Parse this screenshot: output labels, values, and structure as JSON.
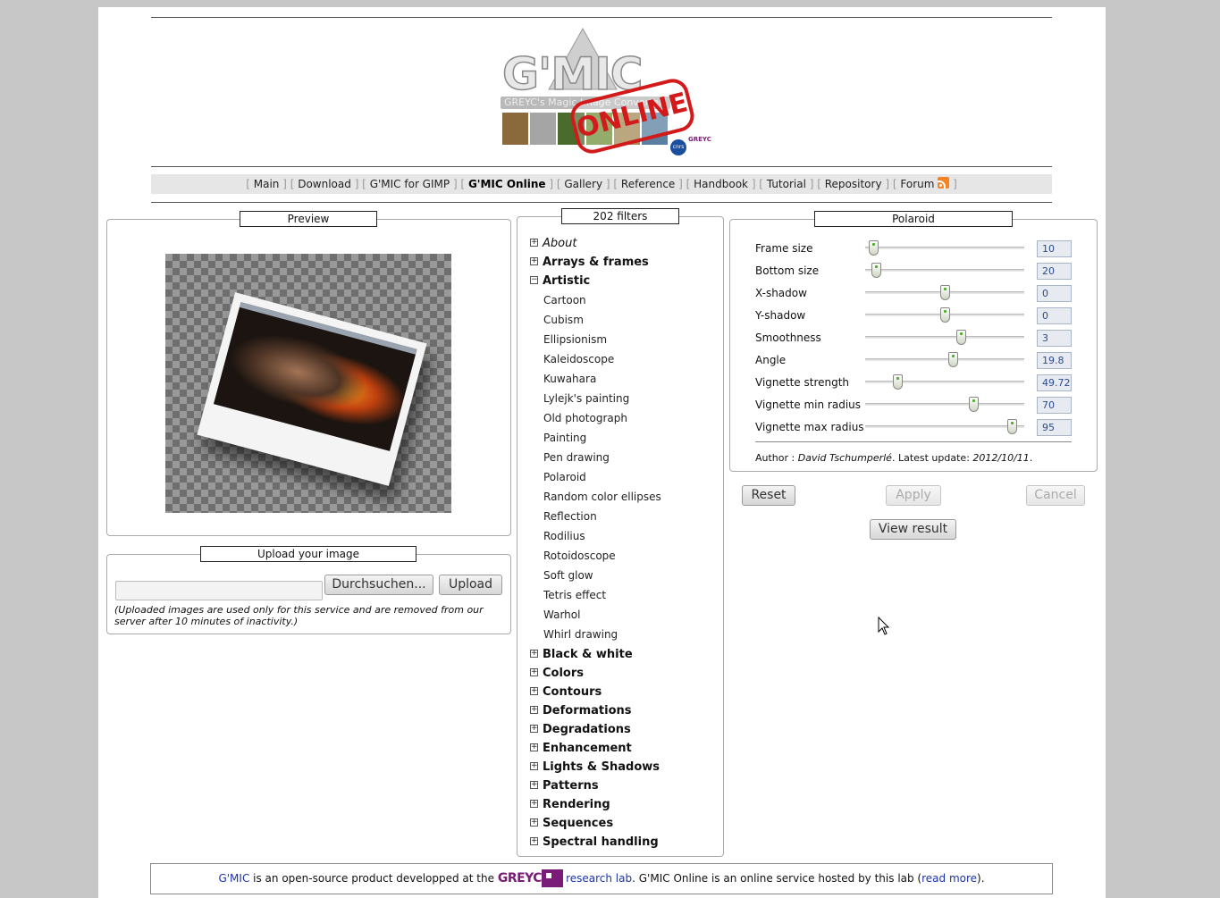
{
  "nav": {
    "items": [
      "Main",
      "Download",
      "G'MIC for GIMP",
      "G'MIC Online",
      "Gallery",
      "Reference",
      "Handbook",
      "Tutorial",
      "Repository",
      "Forum"
    ],
    "active": "G'MIC Online"
  },
  "logo": {
    "title": "G'MIC",
    "subtitle": "GREYC's Magic Image Converter",
    "stamp": "ONLINE",
    "greyc": "GREYC",
    "cnrs": "cnrs"
  },
  "preview": {
    "legend": "Preview"
  },
  "upload": {
    "legend": "Upload your image",
    "browse_label": "Durchsuchen...",
    "upload_label": "Upload",
    "note": "(Uploaded images are used only for this service and are removed from our server after 10 minutes of inactivity.)"
  },
  "filters": {
    "legend": "202 filters",
    "about": "About",
    "categories_before": [
      "Arrays & frames"
    ],
    "open_category": "Artistic",
    "artistic_items": [
      "Cartoon",
      "Cubism",
      "Ellipsionism",
      "Kaleidoscope",
      "Kuwahara",
      "Lylejk's painting",
      "Old photograph",
      "Painting",
      "Pen drawing",
      "Polaroid",
      "Random color ellipses",
      "Reflection",
      "Rodilius",
      "Rotoidoscope",
      "Soft glow",
      "Tetris effect",
      "Warhol",
      "Whirl drawing"
    ],
    "categories_after": [
      "Black & white",
      "Colors",
      "Contours",
      "Deformations",
      "Degradations",
      "Enhancement",
      "Lights & Shadows",
      "Patterns",
      "Rendering",
      "Sequences",
      "Spectral handling"
    ]
  },
  "params": {
    "legend": "Polaroid",
    "items": [
      {
        "label": "Frame size",
        "value": "10",
        "level": 0.05
      },
      {
        "label": "Bottom size",
        "value": "20",
        "level": 0.07
      },
      {
        "label": "X-shadow",
        "value": "0",
        "level": 0.5
      },
      {
        "label": "Y-shadow",
        "value": "0",
        "level": 0.5
      },
      {
        "label": "Smoothness",
        "value": "3",
        "level": 0.6
      },
      {
        "label": "Angle",
        "value": "19.8",
        "level": 0.55
      },
      {
        "label": "Vignette strength",
        "value": "49.725",
        "level": 0.2
      },
      {
        "label": "Vignette min radius",
        "value": "70",
        "level": 0.68
      },
      {
        "label": "Vignette max radius",
        "value": "95",
        "level": 0.92
      }
    ],
    "author_prefix": "Author : ",
    "author": "David Tschumperlé",
    "update_prefix": ". Latest update: ",
    "update_date": "2012/10/11",
    "update_suffix": ".",
    "reset_label": "Reset",
    "apply_label": "Apply",
    "cancel_label": "Cancel",
    "view_label": "View result"
  },
  "footer": {
    "gmic": "G'MIC",
    "text1": " is an open-source product developped at the ",
    "greyc": "GREYC",
    "lab": "research lab",
    "text2": ". G'MIC Online is an online service hosted by this lab (",
    "read_more": "read more",
    "text3": ")."
  }
}
